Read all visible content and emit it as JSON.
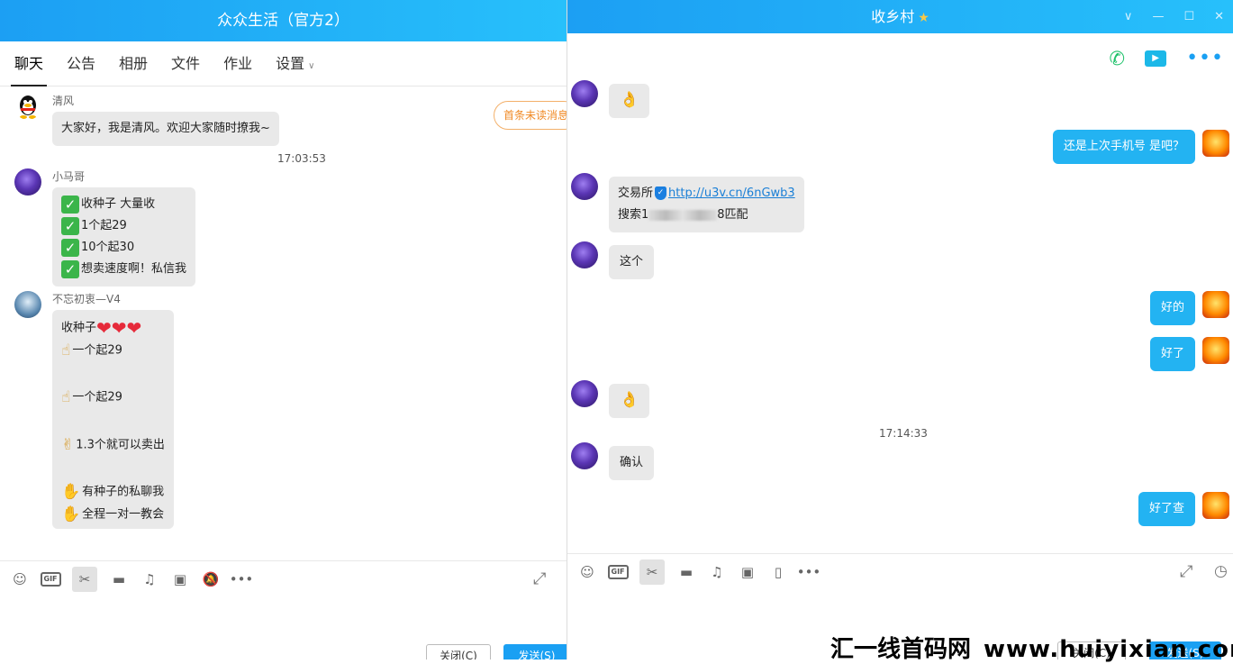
{
  "left": {
    "title": "众众生活（官方2）",
    "tabs": [
      "聊天",
      "公告",
      "相册",
      "文件",
      "作业",
      "设置"
    ],
    "unread_button": "首条未读消息",
    "messages": [
      {
        "sender": "清风",
        "lines": [
          "大家好，我是清风。欢迎大家随时撩我~"
        ]
      },
      {
        "sender": "小马哥",
        "lines": [
          "收种子 大量收",
          "1个起29",
          "10个起30",
          "想卖速度啊！私信我"
        ]
      },
      {
        "sender": "不忘初衷—V4",
        "lines": [
          "收种子",
          "一个起29",
          "一个起29",
          "1.3个就可以卖出",
          "有种子的私聊我",
          "全程一对一教会"
        ]
      }
    ],
    "time1": "17:03:53",
    "close_button": "关闭(C)",
    "send_button": "发送(S)"
  },
  "right": {
    "title": "收乡村",
    "messages_in": {
      "ok_emoji": "👌",
      "exchange_label": "交易所",
      "link": "http://u3v.cn/6nGwb3",
      "search_prefix": "搜索1",
      "search_suffix": "8匹配",
      "zhege": "这个",
      "confirm": "确认"
    },
    "messages_out": [
      "还是上次手机号 是吧？",
      "好的",
      "好了",
      "好了查"
    ],
    "time2": "17:14:33",
    "close_button": "关闭(C)",
    "send_button": "发送(S)"
  },
  "watermark": {
    "cn": "汇一线首码网",
    "url": "www.huiyixian.com"
  },
  "icons": [
    "emoji-icon",
    "gif-icon",
    "scissors-icon",
    "folder-icon",
    "music-icon",
    "image-icon",
    "mute-icon",
    "more-icon",
    "expand-icon",
    "phone-icon",
    "video-icon",
    "history-icon"
  ]
}
